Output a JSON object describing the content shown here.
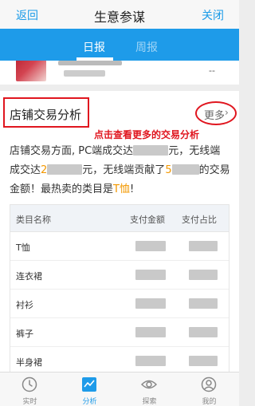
{
  "header": {
    "back_label": "返回",
    "title": "生意参谋",
    "close_label": "关闭"
  },
  "tabs": [
    {
      "label": "日报",
      "active": true
    },
    {
      "label": "周报",
      "active": false
    }
  ],
  "previous_item": {
    "value": "--"
  },
  "section": {
    "title": "店铺交易分析",
    "more_label": "更多",
    "more_arrow": "›",
    "annotation": "点击查看更多的交易分析",
    "summary": {
      "line1_a": "店铺交易方面, PC端成交达",
      "line1_b": "元，无线端",
      "line2_a": "成交达",
      "line2_hl1": "2",
      "line2_b": "元，无线端贡献了",
      "line2_hl2": "5",
      "line2_c": "的交易",
      "line3_a": "金额！最热卖的类目是",
      "line3_hl": "T恤",
      "line3_b": "!"
    },
    "table": {
      "headers": [
        "类目名称",
        "支付金额",
        "支付占比"
      ],
      "rows": [
        {
          "category": "T恤"
        },
        {
          "category": "连衣裙"
        },
        {
          "category": "衬衫"
        },
        {
          "category": "裤子"
        },
        {
          "category": "半身裙"
        }
      ]
    }
  },
  "bottom_nav": [
    {
      "label": "实时",
      "icon": "clock-icon",
      "active": false
    },
    {
      "label": "分析",
      "icon": "chart-icon",
      "active": true
    },
    {
      "label": "探索",
      "icon": "eye-icon",
      "active": false
    },
    {
      "label": "我的",
      "icon": "user-icon",
      "active": false
    }
  ],
  "colors": {
    "brand_blue": "#1e9be9",
    "accent_red": "#e0161f",
    "highlight_orange": "#f39800"
  }
}
